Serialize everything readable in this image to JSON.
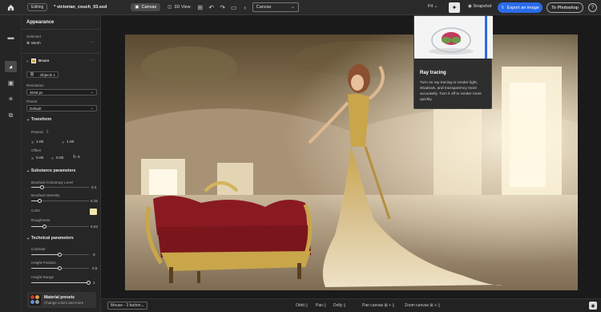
{
  "topbar": {
    "mode_badge": "Editing",
    "filename": "* victorian_couch_03.ssd",
    "canvas_label": "Canvas",
    "view3d_label": "3D View",
    "view_select": "Canvas",
    "fit_label": "Fit",
    "snapshot_label": "Snapshot",
    "export_label": "Export an image",
    "photoshop_label": "To Photoshop"
  },
  "panel": {
    "title": "Appearance",
    "selected_label": "Selected",
    "selected_value": "Mesh",
    "material_name": "Brass",
    "objects_label": "Objects 1",
    "resolution_label": "Resolution",
    "resolution_value": "2048 px",
    "preset_label": "Preset",
    "preset_value": "Default",
    "transform_title": "Transform",
    "repeat_label": "Repeat",
    "repeat_x_label": "X",
    "repeat_x": "1.00",
    "repeat_y_label": "Y",
    "repeat_y": "1.00",
    "offset_label": "Offset",
    "offset_x_label": "X",
    "offset_x": "0.00",
    "offset_y_label": "Y",
    "offset_y": "0.00",
    "offset_rot": "0",
    "substance_title": "Substance parameters",
    "params": [
      {
        "label": "Brushed Anisotropy Level",
        "value": "0.2",
        "level": 0.2
      },
      {
        "label": "Brushed Intensity",
        "value": "0.15",
        "level": 0.15
      }
    ],
    "color_label": "Color",
    "roughness_label": "Roughness",
    "roughness_value": "0.24",
    "roughness_level": 0.24,
    "technical_title": "Technical parameters",
    "tech_params": [
      {
        "label": "Contrast",
        "value": "0",
        "level": 0.5
      },
      {
        "label": "Height Position",
        "value": "0.5",
        "level": 0.5
      },
      {
        "label": "Height Range",
        "value": "1",
        "level": 1.0
      }
    ],
    "presets_title": "Material presets",
    "presets_sub": "Change colors and more"
  },
  "tooltip": {
    "title": "Ray tracing",
    "body": "Turn on ray tracing to render light, shadows, and transparency more accurately. Turn it off to render more quickly."
  },
  "bottombar": {
    "mouse_select": "Mouse - 3 button",
    "orbit": "Orbit",
    "pan": "Pan",
    "dolly": "Dolly",
    "pan_canvas": "Pan canvas",
    "zoom_canvas": "Zoom canvas"
  },
  "colors": {
    "accent": "#2b6be8",
    "swatch": "#f1e6ac",
    "couch_red": "#8a1a22",
    "gold": "#c9a64a"
  }
}
